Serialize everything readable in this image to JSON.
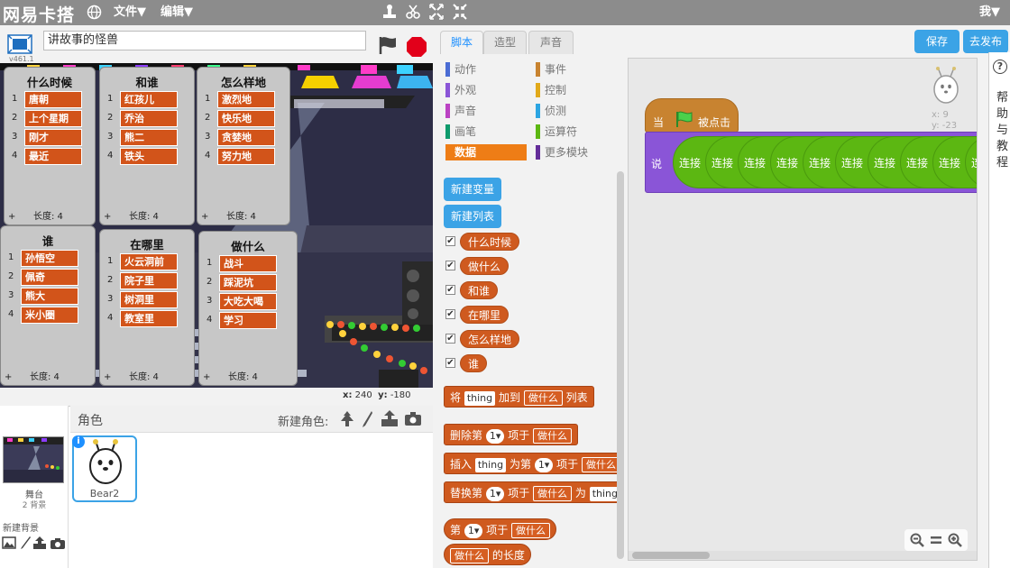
{
  "topbar": {
    "brand": "网易卡搭",
    "menu_file": "文件▼",
    "menu_edit": "编辑▼",
    "user": "我▼"
  },
  "stage_header": {
    "project_title": "讲故事的怪兽",
    "version": "v461.1"
  },
  "monitors": [
    {
      "title": "什么时候",
      "items": [
        "唐朝",
        "上个星期",
        "刚才",
        "最近"
      ],
      "length_label": "长度: 4"
    },
    {
      "title": "和谁",
      "items": [
        "红孩儿",
        "乔治",
        "熊二",
        "铁头"
      ],
      "length_label": "长度: 4"
    },
    {
      "title": "怎么样地",
      "items": [
        "激烈地",
        "快乐地",
        "贪婪地",
        "努力地"
      ],
      "length_label": "长度: 4"
    },
    {
      "title": "谁",
      "items": [
        "孙悟空",
        "佩奇",
        "熊大",
        "米小圈"
      ],
      "length_label": "长度: 4"
    },
    {
      "title": "在哪里",
      "items": [
        "火云洞前",
        "院子里",
        "树洞里",
        "教室里"
      ],
      "length_label": "长度: 4"
    },
    {
      "title": "做什么",
      "items": [
        "战斗",
        "踩泥坑",
        "大吃大喝",
        "学习"
      ],
      "length_label": "长度: 4"
    }
  ],
  "stage_coords": {
    "x_label": "x:",
    "x_value": "240",
    "y_label": "y:",
    "y_value": "-180"
  },
  "sprite_pane": {
    "header": "角色",
    "new_sprite_label": "新建角色:",
    "stage_label": "舞台",
    "stage_backdrops": "2 背景",
    "new_backdrop_label": "新建背景",
    "sprite_name": "Bear2"
  },
  "tabs": [
    "脚本",
    "造型",
    "声音"
  ],
  "categories_left": [
    {
      "label": "动作",
      "color": "#4a6cd4"
    },
    {
      "label": "外观",
      "color": "#8a55d7"
    },
    {
      "label": "声音",
      "color": "#bb42c3"
    },
    {
      "label": "画笔",
      "color": "#0e9a6c"
    },
    {
      "label": "数据",
      "color": "#ee7d16"
    }
  ],
  "categories_right": [
    {
      "label": "事件",
      "color": "#c88330"
    },
    {
      "label": "控制",
      "color": "#e1a91a"
    },
    {
      "label": "侦测",
      "color": "#2ca5e2"
    },
    {
      "label": "运算符",
      "color": "#5cb712"
    },
    {
      "label": "更多模块",
      "color": "#632d99"
    }
  ],
  "palette": {
    "new_variable": "新建变量",
    "new_list": "新建列表",
    "list_reporters": [
      "什么时候",
      "做什么",
      "和谁",
      "在哪里",
      "怎么样地",
      "谁"
    ],
    "add_block": {
      "prefix": "将",
      "input": "thing",
      "mid": "加到",
      "dropdown": "做什么",
      "suffix": "列表"
    },
    "delete_block": {
      "prefix": "删除第",
      "num": "1▾",
      "mid": "项于",
      "dropdown": "做什么"
    },
    "insert_block": {
      "prefix": "插入",
      "input": "thing",
      "mid1": "为第",
      "num": "1▾",
      "mid2": "项于",
      "dropdown": "做什么"
    },
    "replace_block": {
      "prefix": "替换第",
      "num": "1▾",
      "mid1": "项于",
      "dropdown": "做什么",
      "mid2": "为",
      "input": "thing"
    },
    "item_block": {
      "prefix": "第",
      "num": "1▾",
      "mid": "项于",
      "dropdown": "做什么"
    },
    "length_block": {
      "dropdown": "做什么",
      "suffix": "的长度"
    }
  },
  "top_buttons": {
    "save": "保存",
    "publish": "去发布"
  },
  "scripts": {
    "sprite_x": "x: 9",
    "sprite_y": "y: -23",
    "hat_prefix": "当",
    "hat_suffix": "被点击",
    "say_label": "说",
    "join_label": "连接"
  },
  "help": {
    "icon": "?",
    "text": "帮助与教程"
  }
}
